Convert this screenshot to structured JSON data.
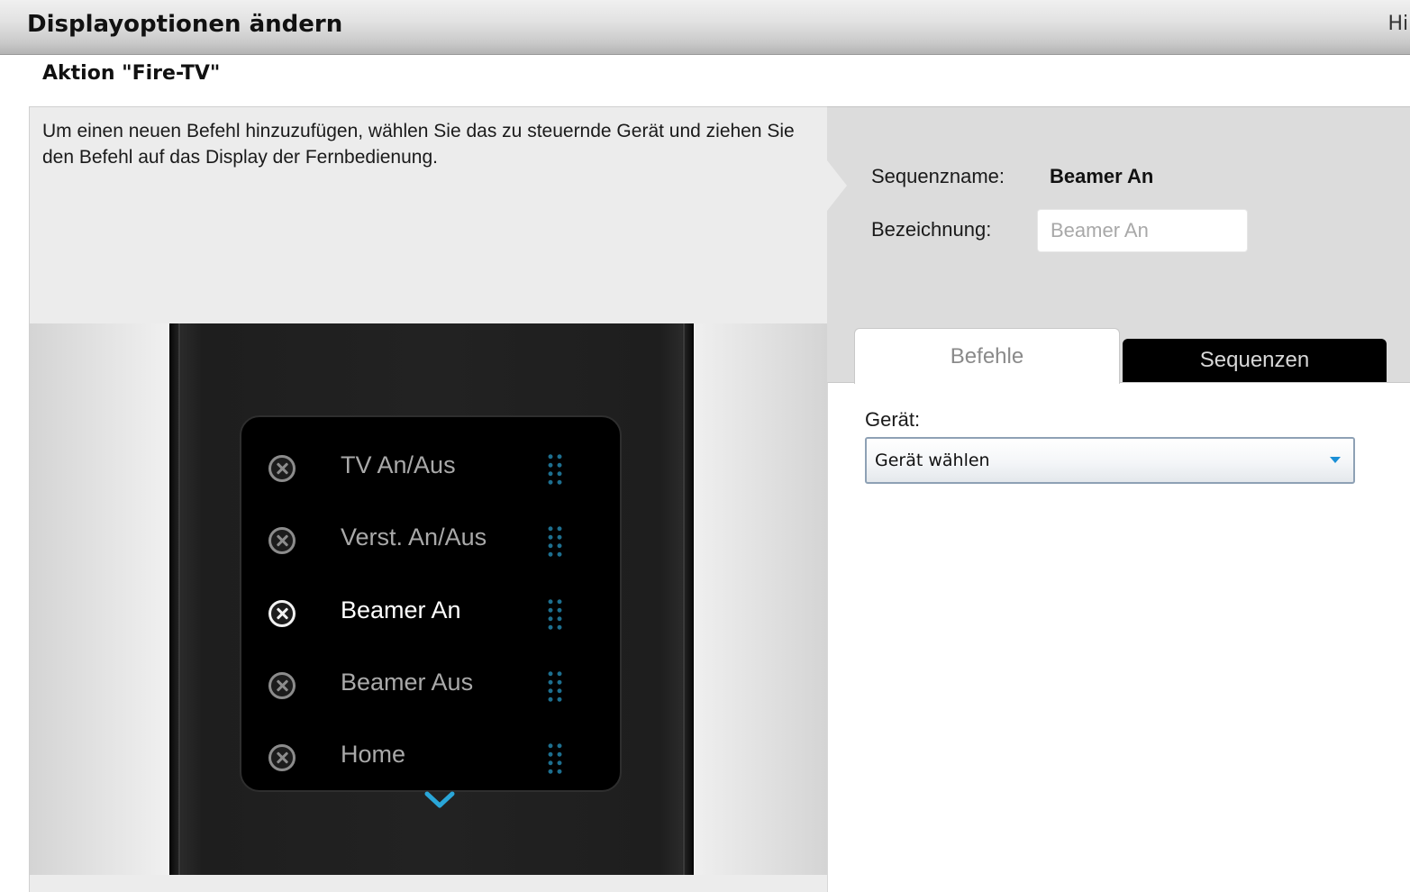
{
  "header": {
    "title": "Displayoptionen ändern",
    "help_label": "Hilf"
  },
  "action": {
    "title": "Aktion \"Fire-TV\""
  },
  "instruction": "Um einen neuen Befehl hinzuzufügen, wählen Sie das zu steuernde Gerät und ziehen Sie den Befehl auf das Display der Fernbedienung.",
  "remote": {
    "commands": [
      {
        "label": "TV An/Aus",
        "active": false
      },
      {
        "label": "Verst. An/Aus",
        "active": false
      },
      {
        "label": "Beamer An",
        "active": true
      },
      {
        "label": "Beamer Aus",
        "active": false
      },
      {
        "label": "Home",
        "active": false
      }
    ]
  },
  "sequence": {
    "name_label": "Sequenzname:",
    "name_value": "Beamer An",
    "designation_label": "Bezeichnung:",
    "designation_placeholder": "Beamer An"
  },
  "tabs": {
    "commands": "Befehle",
    "sequences": "Sequenzen"
  },
  "device": {
    "label": "Gerät:",
    "selected": "Gerät wählen"
  },
  "colors": {
    "drag_handle": "#1d6f8f",
    "select_caret": "#1a8fd6",
    "active_text": "#ffffff",
    "inactive_text": "#a9a9a9"
  }
}
